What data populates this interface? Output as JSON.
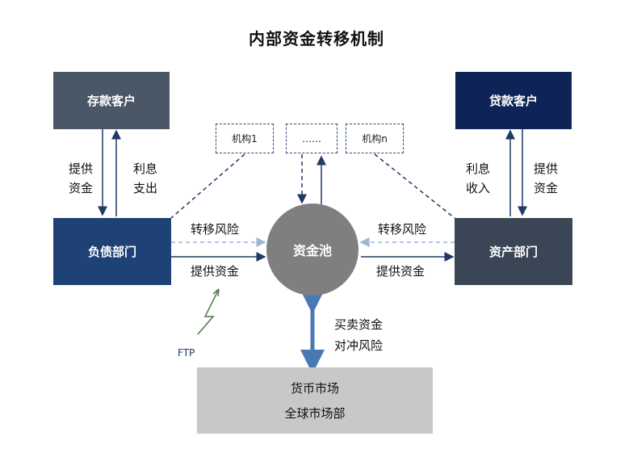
{
  "title": "内部资金转移机制",
  "nodes": {
    "deposit_customer": "存款客户",
    "loan_customer": "贷款客户",
    "liability_dept": "负债部门",
    "asset_dept": "资产部门",
    "fund_pool": "资金池",
    "institution_1": "机构1",
    "institution_dots": "……",
    "institution_n": "机构n",
    "market_line1": "货币市场",
    "market_line2": "全球市场部"
  },
  "labels": {
    "left_provide_1": "提供",
    "left_provide_2": "资金",
    "left_interest_1": "利息",
    "left_interest_2": "支出",
    "right_interest_1": "利息",
    "right_interest_2": "收入",
    "right_provide_1": "提供",
    "right_provide_2": "资金",
    "left_transfer_risk": "转移风险",
    "left_provide_funds": "提供资金",
    "right_transfer_risk": "转移风险",
    "right_provide_funds": "提供资金",
    "trade_funds": "买卖资金",
    "hedge_risk": "对冲风险",
    "ftp": "FTP"
  },
  "colors": {
    "deposit_customer": "#4a5766",
    "loan_customer": "#0f2456",
    "liability_dept": "#1e4275",
    "asset_dept": "#3a4655",
    "fund_pool": "#7f7f7f",
    "market": "#c8c8c8",
    "arrow_dark": "#1f3a66",
    "arrow_light": "#9db4d6",
    "arrow_blue": "#4a78b5"
  }
}
